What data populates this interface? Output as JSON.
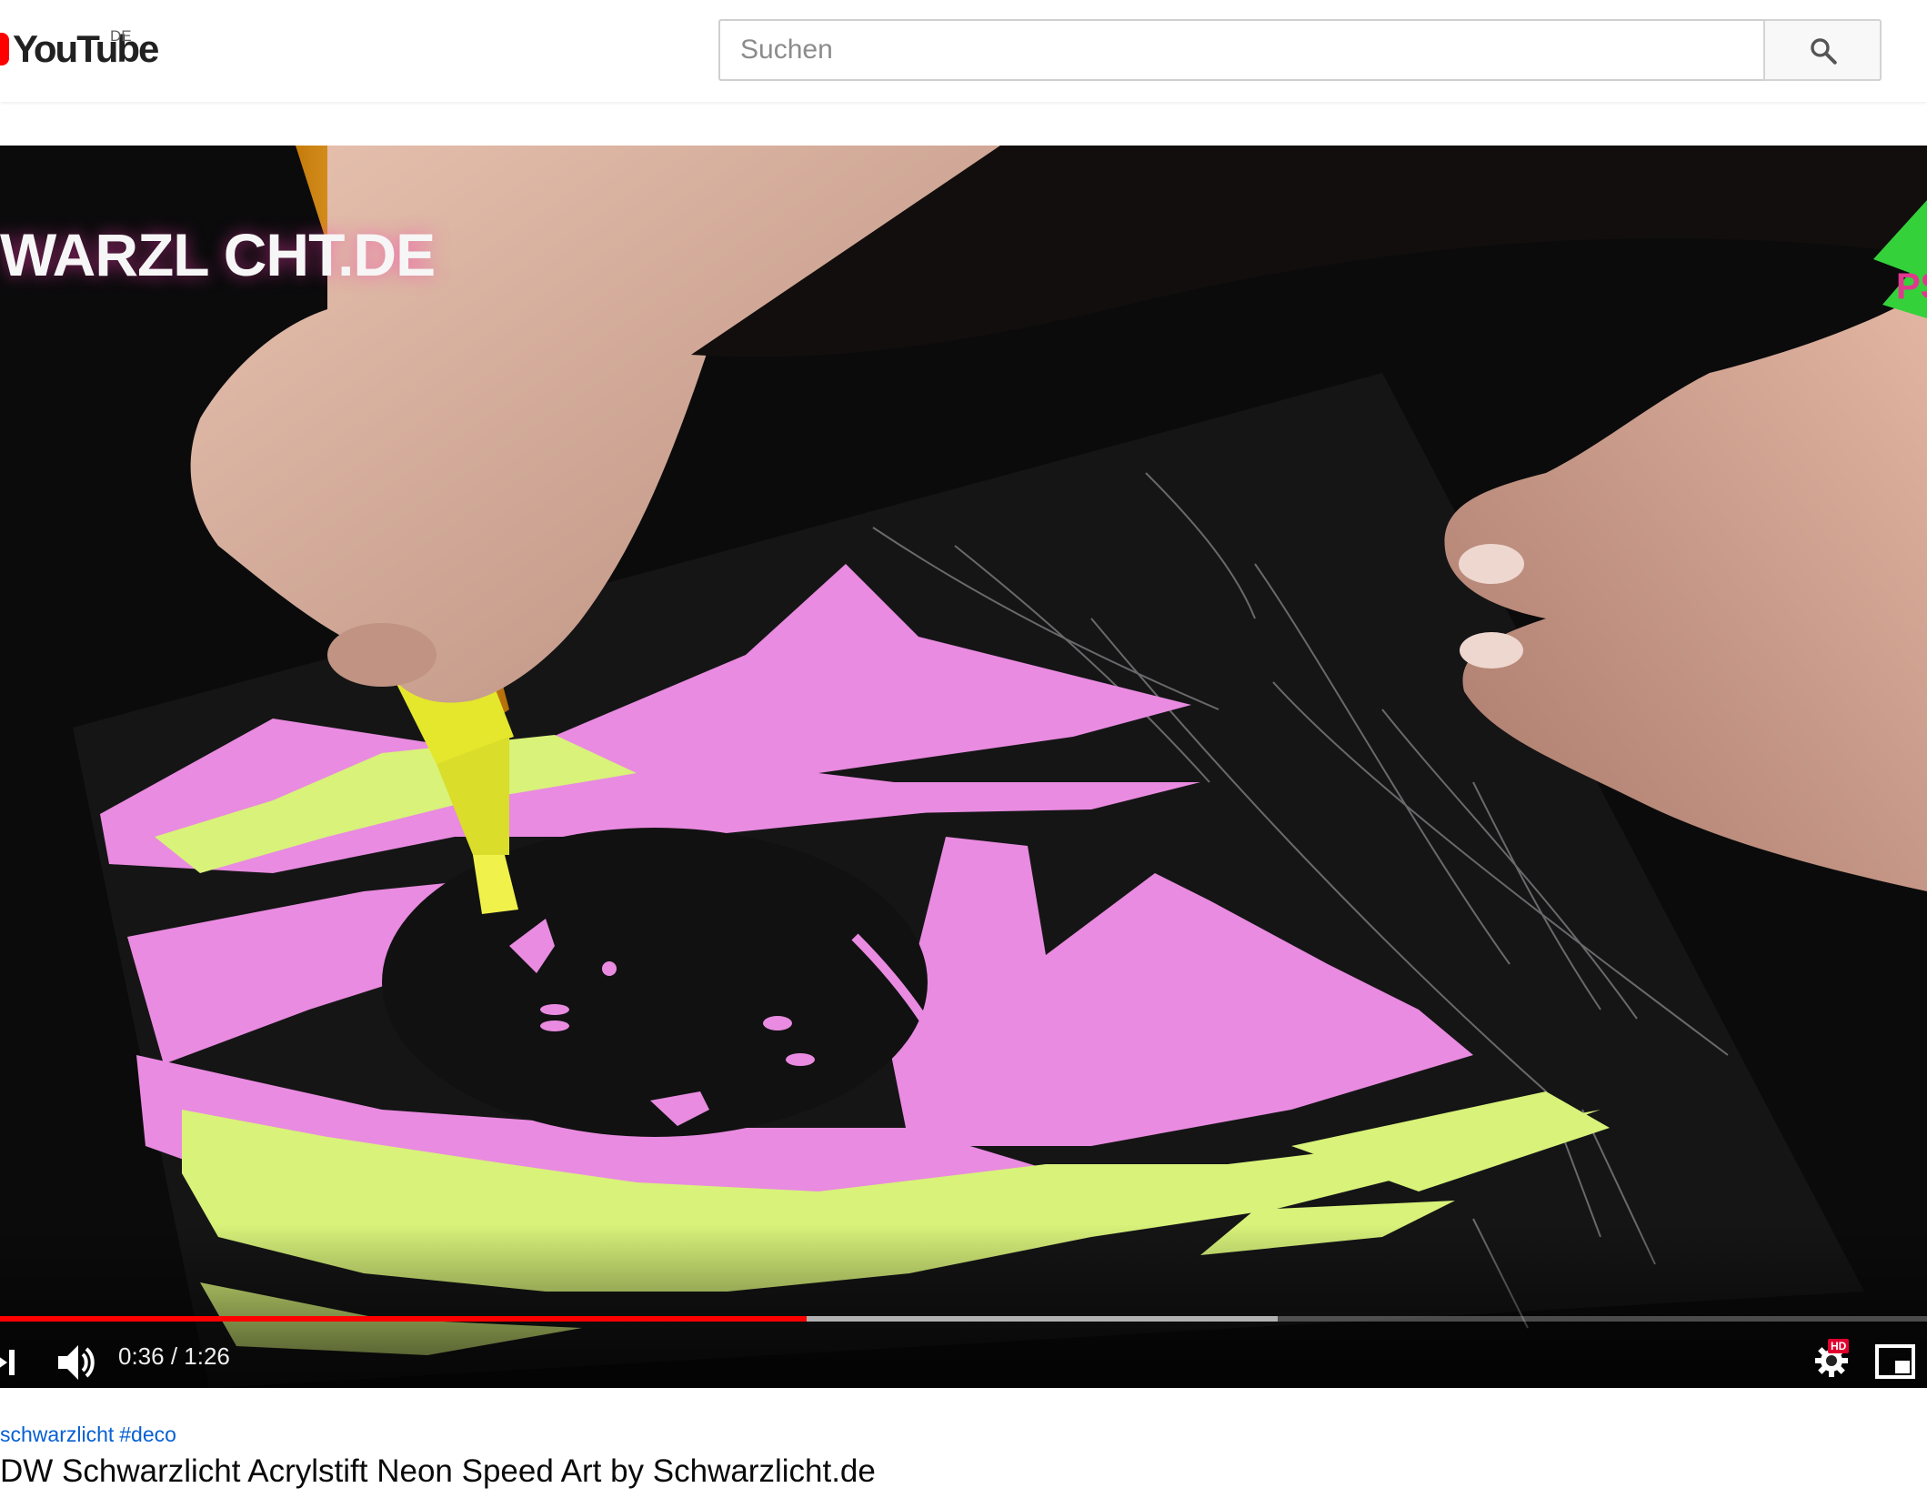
{
  "masthead": {
    "logo_text": "YouTube",
    "country_code": "DE",
    "search": {
      "placeholder": "Suchen"
    }
  },
  "player": {
    "watermark_text": "WARZL CHT.DE",
    "current_time": "0:36",
    "duration": "1:26",
    "time_separator": " / ",
    "progress_fraction": 0.4186,
    "buffered_fraction": 0.663,
    "hd_badge": "HD"
  },
  "video_info": {
    "hashtags": [
      "schwarzlicht",
      "#deco"
    ],
    "title": "DW Schwarzlicht Acrylstift Neon Speed Art by Schwarzlicht.de"
  },
  "icons": [
    "youtube-logo-icon",
    "search-icon",
    "next-icon",
    "volume-icon",
    "settings-icon",
    "miniplayer-icon"
  ],
  "colors": {
    "brand_red": "#ff0000",
    "neon_pink": "#e98be0",
    "neon_yellow": "#d8f27a",
    "link_blue": "#065fd4"
  }
}
